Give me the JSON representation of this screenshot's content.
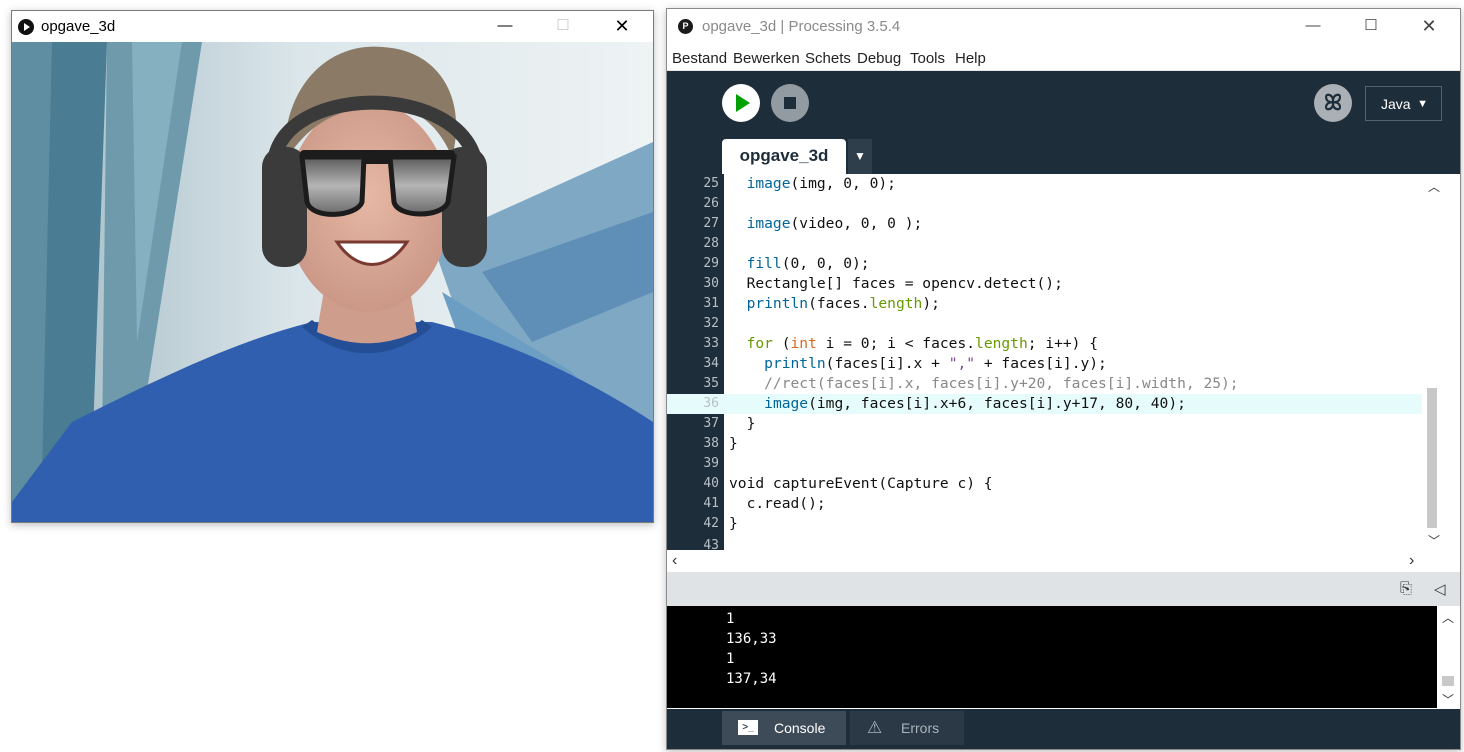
{
  "sketch_window": {
    "title": "opgave_3d"
  },
  "ide": {
    "title": "opgave_3d | Processing 3.5.4",
    "menu": [
      "Bestand",
      "Bewerken",
      "Schets",
      "Debug",
      "Tools",
      "Help"
    ],
    "mode": "Java",
    "tab_label": "opgave_3d",
    "current_line": 36,
    "code_lines": [
      {
        "n": "25",
        "t": "  image(img, 0, 0);"
      },
      {
        "n": "26",
        "t": ""
      },
      {
        "n": "27",
        "t": "  image(video, 0, 0 );"
      },
      {
        "n": "28",
        "t": ""
      },
      {
        "n": "29",
        "t": "  fill(0, 0, 0);"
      },
      {
        "n": "30",
        "t": "  Rectangle[] faces = opencv.detect();"
      },
      {
        "n": "31",
        "t": "  println(faces.length);"
      },
      {
        "n": "32",
        "t": ""
      },
      {
        "n": "33",
        "t": "  for (int i = 0; i < faces.length; i++) {"
      },
      {
        "n": "34",
        "t": "    println(faces[i].x + \",\" + faces[i].y);"
      },
      {
        "n": "35",
        "t": "    //rect(faces[i].x, faces[i].y+20, faces[i].width, 25);"
      },
      {
        "n": "36",
        "t": "    image(img, faces[i].x+6, faces[i].y+17, 80, 40);"
      },
      {
        "n": "37",
        "t": "  }"
      },
      {
        "n": "38",
        "t": "}"
      },
      {
        "n": "39",
        "t": ""
      },
      {
        "n": "40",
        "t": "void captureEvent(Capture c) {"
      },
      {
        "n": "41",
        "t": "  c.read();"
      },
      {
        "n": "42",
        "t": "}"
      },
      {
        "n": "43",
        "t": ""
      }
    ],
    "console_lines": [
      "1",
      "136,33",
      "1",
      "137,34"
    ],
    "console_tab": "Console",
    "errors_tab": "Errors"
  },
  "colors": {
    "toolbar_bg": "#1e2d3a",
    "run_green": "#00a000",
    "fn_blue": "#006699",
    "type_orange": "#e2661a",
    "ctrl_green": "#669900",
    "string_purple": "#7d4793",
    "comment_gray": "#888888",
    "current_line": "#e6fcfc"
  }
}
